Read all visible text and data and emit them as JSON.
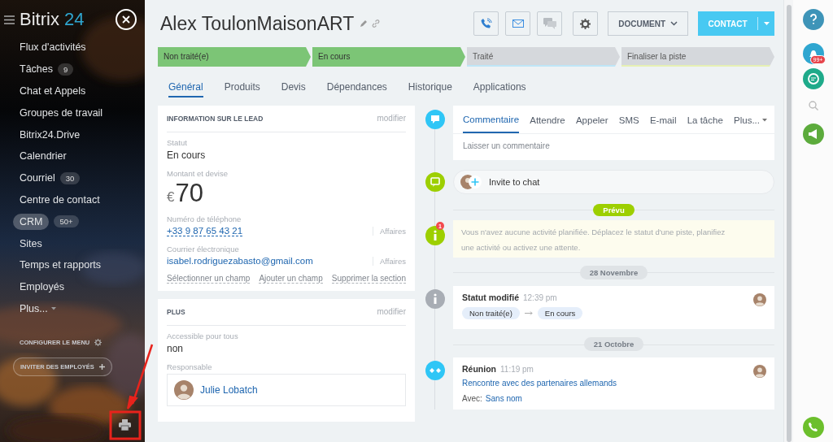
{
  "sidebar": {
    "logo": {
      "name": "Bitrix",
      "suffix": "24"
    },
    "items": [
      {
        "label": "Flux d'activités",
        "selected": false
      },
      {
        "label": "Tâches",
        "counter": "9",
        "selected": false
      },
      {
        "label": "Chat et Appels",
        "selected": false
      },
      {
        "label": "Groupes de travail",
        "selected": false
      },
      {
        "label": "Bitrix24.Drive",
        "selected": false
      },
      {
        "label": "Calendrier",
        "selected": false
      },
      {
        "label": "Courriel",
        "counter": "30",
        "selected": false
      },
      {
        "label": "Centre de contact",
        "selected": false
      },
      {
        "label": "CRM",
        "counter": "50+",
        "selected": true
      },
      {
        "label": "Sites",
        "selected": false
      },
      {
        "label": "Temps et rapports",
        "selected": false
      },
      {
        "label": "Employés",
        "selected": false
      },
      {
        "label": "Plus...",
        "kind": "more",
        "selected": false
      }
    ],
    "configure": "CONFIGURER LE MENU",
    "invite": "INVITER DES EMPLOYÉS"
  },
  "header": {
    "title": "Alex ToulonMaisonART",
    "document_button": "DOCUMENT",
    "contact_button": "CONTACT"
  },
  "stages": [
    {
      "label": "Non traité(e)",
      "done": true,
      "color": "#7cc576"
    },
    {
      "label": "En cours",
      "done": true,
      "color": "#7cc576"
    },
    {
      "label": "Traité",
      "done": false,
      "color": "#bfe6f7"
    },
    {
      "label": "Finaliser la piste",
      "done": false,
      "color": "#e6f0b4"
    }
  ],
  "tabs": [
    {
      "label": "Général",
      "selected": true
    },
    {
      "label": "Produits",
      "selected": false
    },
    {
      "label": "Devis",
      "selected": false
    },
    {
      "label": "Dépendances",
      "selected": false
    },
    {
      "label": "Historique",
      "selected": false
    },
    {
      "label": "Applications",
      "selected": false
    }
  ],
  "lead_card": {
    "title": "INFORMATION SUR LE LEAD",
    "edit": "modifier",
    "fields": [
      {
        "kind": "text",
        "label": "Statut",
        "value": "En cours"
      },
      {
        "kind": "money",
        "label": "Montant et devise",
        "currency": "€",
        "value": "70"
      },
      {
        "kind": "link",
        "label": "Numéro de téléphone",
        "value": "+33 9 87 65 43 21",
        "type_label": "Affaires"
      },
      {
        "kind": "link",
        "label": "Courrier électronique",
        "value": "isabel.rodriguezabasto@gmail.com",
        "type_label": "Affaires"
      }
    ],
    "actions": [
      "Sélectionner un champ",
      "Ajouter un champ",
      "Supprimer la section"
    ]
  },
  "more_card": {
    "title": "PLUS",
    "edit": "modifier",
    "fields": [
      {
        "kind": "text",
        "label": "Accessible pour tous",
        "value": "non"
      },
      {
        "kind": "user",
        "label": "Responsable",
        "value": "Julie Lobatch"
      }
    ]
  },
  "timeline": {
    "composer": {
      "tabs": [
        {
          "label": "Commentaire",
          "selected": true
        },
        {
          "label": "Attendre",
          "selected": false
        },
        {
          "label": "Appeler",
          "selected": false
        },
        {
          "label": "SMS",
          "selected": false
        },
        {
          "label": "E-mail",
          "selected": false
        },
        {
          "label": "La tâche",
          "selected": false
        },
        {
          "label": "Plus...",
          "selected": false
        }
      ],
      "placeholder": "Laisser un commentaire"
    },
    "invite": "Invite to chat",
    "planned_label": "Prévu",
    "planned_badge": "1",
    "planned_text": "Vous n'avez aucune activité planifiée. Déplacez le statut d'une piste, planifiez une activité ou activez une attente.",
    "entries": [
      {
        "kind": "status",
        "date": "28 Novembre",
        "title": "Statut modifié",
        "time": "12:39 pm",
        "from": "Non traité(e)",
        "to": "En cours"
      },
      {
        "kind": "meeting",
        "date": "21 Octobre",
        "title": "Réunion",
        "time": "11:19 pm",
        "link": "Rencontre avec des partenaires allemands",
        "with_label": "Avec:",
        "with_value": "Sans nom"
      }
    ]
  },
  "right_bar": {
    "notification_count": "99+"
  }
}
